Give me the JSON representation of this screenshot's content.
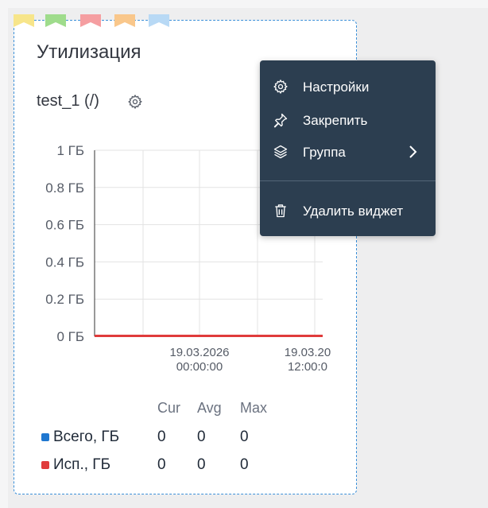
{
  "theme": {
    "widget_border": "#3a8fd8",
    "menu_bg": "#2c3e50",
    "flag_colors": [
      "#f7e58a",
      "#9fdc8c",
      "#f59ea1",
      "#f9c78b",
      "#b8d9f5"
    ]
  },
  "widget": {
    "title": "Утилизация",
    "subtitle": "test_1 (/)",
    "subtitle_icon": "gear-icon"
  },
  "chart_data": {
    "type": "line",
    "y_tick_labels": [
      "1 ГБ",
      "0.8 ГБ",
      "0.6 ГБ",
      "0.4 ГБ",
      "0.2 ГБ",
      "0 ГБ"
    ],
    "y_ticks": [
      1,
      0.8,
      0.6,
      0.4,
      0.2,
      0
    ],
    "ylim": [
      0,
      1
    ],
    "x_tick_labels": [
      {
        "date": "19.03.2026",
        "time": "00:00:00"
      },
      {
        "date": "19.03.20",
        "time": "12:00:0"
      }
    ],
    "grid": true,
    "series": [
      {
        "name": "Всего, ГБ",
        "color": "#1f77d0",
        "values": [
          0,
          0
        ]
      },
      {
        "name": "Исп., ГБ",
        "color": "#e03b3b",
        "values": [
          0,
          0
        ]
      }
    ]
  },
  "legend": {
    "headers": [
      "Cur",
      "Avg",
      "Max"
    ],
    "rows": [
      {
        "name": "Всего, ГБ",
        "color": "#1f77d0",
        "cur": "0",
        "avg": "0",
        "max": "0"
      },
      {
        "name": "Исп., ГБ",
        "color": "#e03b3b",
        "cur": "0",
        "avg": "0",
        "max": "0"
      }
    ]
  },
  "context_menu": {
    "items": [
      {
        "label": "Настройки",
        "icon": "gear-icon"
      },
      {
        "label": "Закрепить",
        "icon": "pin-icon"
      },
      {
        "label": "Группа",
        "icon": "layers-icon",
        "submenu_icon": "chevron-right-icon"
      },
      {
        "label": "Удалить виджет",
        "icon": "trash-icon"
      }
    ]
  }
}
